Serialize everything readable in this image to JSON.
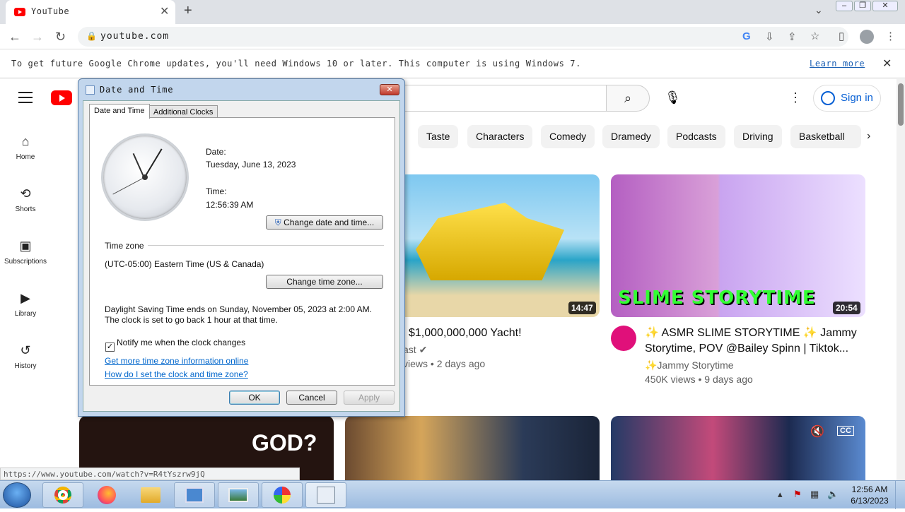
{
  "browser": {
    "tab_title": "YouTube",
    "new_tab": "+",
    "url": "youtube.com",
    "banner_text": "To get future Google Chrome updates, you'll need Windows 10 or later. This computer is using Windows 7.",
    "banner_link": "Learn more",
    "status_url": "https://www.youtube.com/watch?v=R4tYszrw9jQ"
  },
  "youtube": {
    "sign_in": "Sign in",
    "sidebar": [
      {
        "label": "Home",
        "icon": "home-icon"
      },
      {
        "label": "Shorts",
        "icon": "shorts-icon"
      },
      {
        "label": "Subscriptions",
        "icon": "subscriptions-icon"
      },
      {
        "label": "Library",
        "icon": "library-icon"
      },
      {
        "label": "History",
        "icon": "history-icon"
      }
    ],
    "chips": [
      "Taste",
      "Characters",
      "Comedy",
      "Dramedy",
      "Podcasts",
      "Driving",
      "Basketball"
    ],
    "videos": [
      {
        "title": "$1,000,000,000 Yacht!",
        "channel": "ast",
        "meta": "views • 2 days ago",
        "duration": "14:47"
      },
      {
        "title": "✨ ASMR SLIME STORYTIME ✨ Jammy Storytime, POV @Bailey Spinn | Tiktok...",
        "channel": "✨Jammy Storytime",
        "meta": "450K views • 9 days ago",
        "duration": "20:54",
        "thumb_text": "SLIME STORYTIME"
      }
    ],
    "row2_thumb_text": "GOD?"
  },
  "dialog": {
    "title": "Date and Time",
    "tabs": [
      "Date and Time",
      "Additional Clocks"
    ],
    "date_label": "Date:",
    "date_value": "Tuesday, June 13, 2023",
    "time_label": "Time:",
    "time_value": "12:56:39 AM",
    "change_datetime": "Change date and time...",
    "timezone_heading": "Time zone",
    "timezone_value": "(UTC-05:00) Eastern Time (US & Canada)",
    "change_timezone": "Change time zone...",
    "dst_text": "Daylight Saving Time ends on Sunday, November 05, 2023 at 2:00 AM. The clock is set to go back 1 hour at that time.",
    "notify_label": "Notify me when the clock changes",
    "notify_checked": true,
    "link1": "Get more time zone information online",
    "link2": "How do I set the clock and time zone?",
    "ok": "OK",
    "cancel": "Cancel",
    "apply": "Apply"
  },
  "taskbar": {
    "time": "12:56 AM",
    "date": "6/13/2023"
  }
}
